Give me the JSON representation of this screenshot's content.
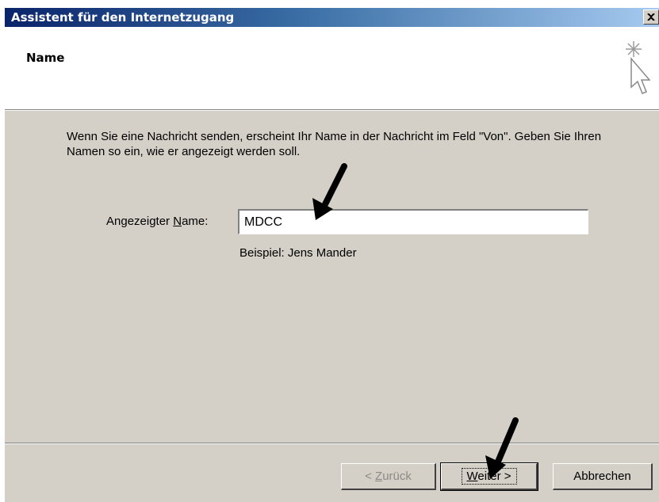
{
  "window": {
    "title": "Assistent für den Internetzugang",
    "close_symbol": "✕"
  },
  "header": {
    "title": "Name",
    "icon": "wizard-sparkle-cursor-icon"
  },
  "content": {
    "description": "Wenn Sie eine Nachricht senden, erscheint Ihr Name in der Nachricht im Feld \"Von\". Geben Sie Ihren Namen so ein, wie er angezeigt werden soll.",
    "name_label_before": "Angezeigter ",
    "name_label_access": "N",
    "name_label_after": "ame:",
    "name_value": "MDCC",
    "example": "Beispiel: Jens Mander"
  },
  "buttons": {
    "back": {
      "prefix": "< ",
      "access": "Z",
      "rest": "urück",
      "enabled": false
    },
    "next": {
      "access": "W",
      "rest": "eiter >",
      "enabled": true
    },
    "cancel": {
      "label": "Abbrechen",
      "enabled": true
    }
  },
  "annotations": {
    "arrow_color": "#000000"
  }
}
